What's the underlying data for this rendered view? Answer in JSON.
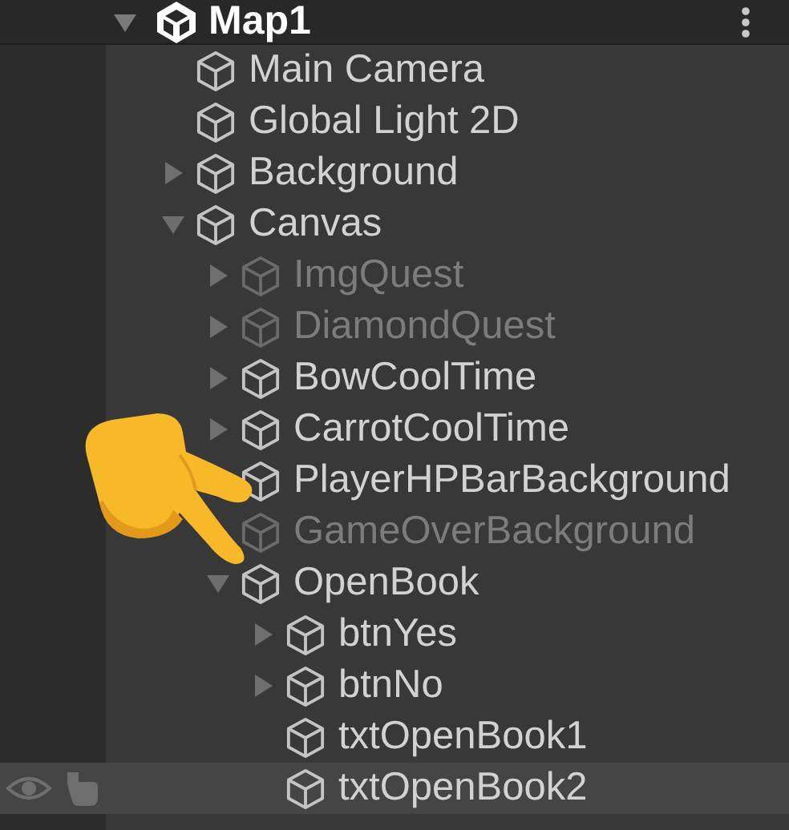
{
  "scene": {
    "title": "Map1",
    "expanded": true,
    "children": [
      {
        "name": "Main Camera",
        "active": true,
        "hovered": false
      },
      {
        "name": "Global Light 2D",
        "active": true,
        "hovered": false
      },
      {
        "name": "Background",
        "active": true,
        "hovered": false,
        "expanded": false
      },
      {
        "name": "Canvas",
        "active": true,
        "hovered": false,
        "expanded": true,
        "children": [
          {
            "name": "ImgQuest",
            "active": false,
            "hovered": false,
            "expanded": false
          },
          {
            "name": "DiamondQuest",
            "active": false,
            "hovered": false,
            "expanded": false
          },
          {
            "name": "BowCoolTime",
            "active": true,
            "hovered": false,
            "expanded": false
          },
          {
            "name": "CarrotCoolTime",
            "active": true,
            "hovered": false,
            "expanded": false
          },
          {
            "name": "PlayerHPBarBackground",
            "active": true,
            "hovered": false
          },
          {
            "name": "GameOverBackground",
            "active": false,
            "hovered": false,
            "expanded": false
          },
          {
            "name": "OpenBook",
            "active": true,
            "hovered": false,
            "expanded": true,
            "children": [
              {
                "name": "btnYes",
                "active": true,
                "hovered": false,
                "expanded": false
              },
              {
                "name": "btnNo",
                "active": true,
                "hovered": false,
                "expanded": false
              },
              {
                "name": "txtOpenBook1",
                "active": true,
                "hovered": false
              },
              {
                "name": "txtOpenBook2",
                "active": true,
                "hovered": true
              }
            ]
          }
        ]
      }
    ]
  }
}
